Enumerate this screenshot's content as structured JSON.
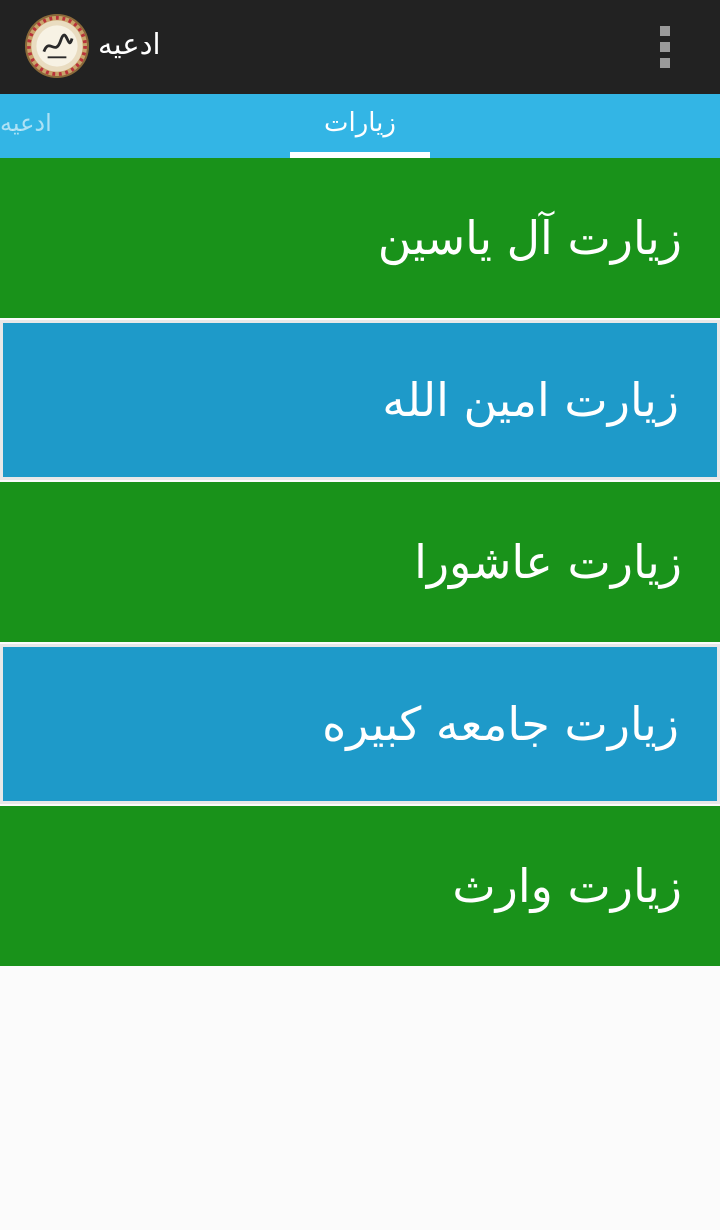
{
  "app_bar": {
    "title": "ادعیه",
    "icon": "calligraphy-logo-icon",
    "overflow_icon": "overflow-menu-icon"
  },
  "tabs": [
    {
      "label": "ادعیه",
      "active": false
    },
    {
      "label": "زیارات",
      "active": true
    }
  ],
  "list": {
    "items": [
      {
        "label": "زیارت آل یاسین",
        "color": "#19921a"
      },
      {
        "label": "زیارت امین الله",
        "color": "#1e9ac9"
      },
      {
        "label": "زیارت عاشورا",
        "color": "#19921a"
      },
      {
        "label": "زیارت جامعه کبیره",
        "color": "#1e9ac9"
      },
      {
        "label": "زیارت وارث",
        "color": "#19921a"
      }
    ]
  },
  "colors": {
    "app_bar": "#222222",
    "tab_bar": "#33b5e5",
    "green": "#19921a",
    "blue": "#1e9ac9"
  }
}
